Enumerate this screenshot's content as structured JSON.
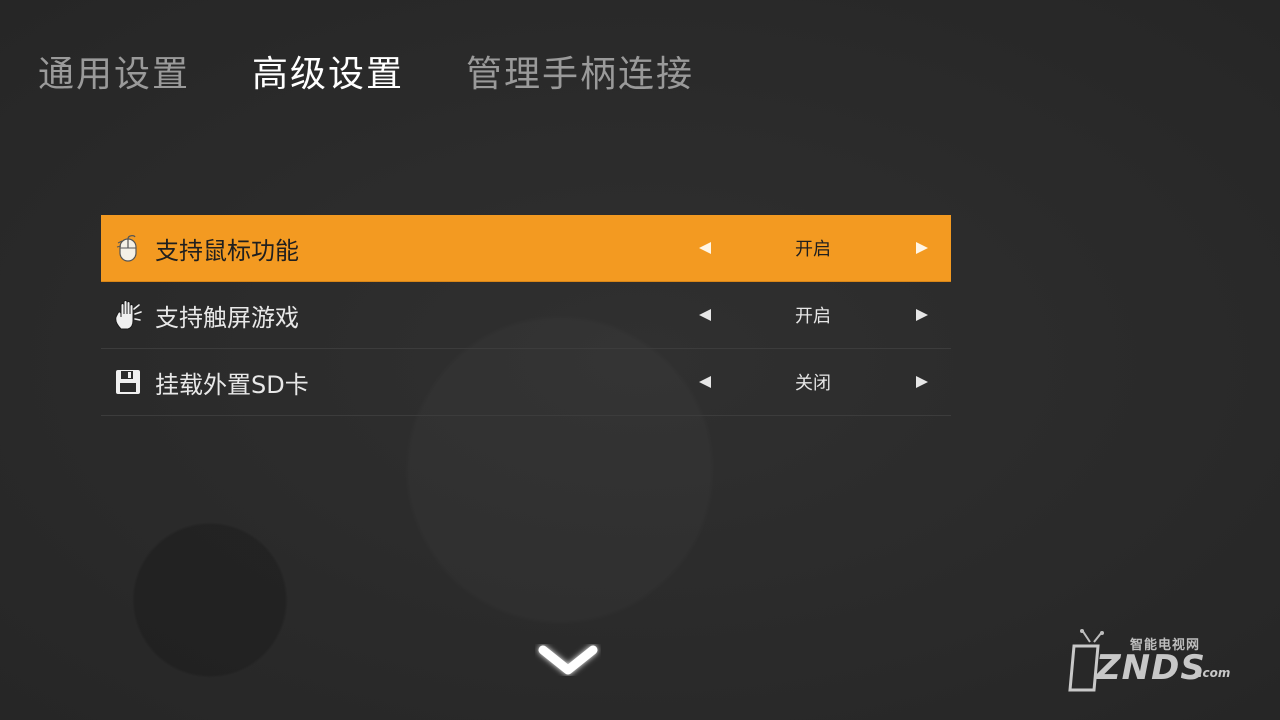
{
  "tabs": [
    {
      "label": "通用设置",
      "active": false
    },
    {
      "label": "高级设置",
      "active": true
    },
    {
      "label": "管理手柄连接",
      "active": false
    }
  ],
  "settings": [
    {
      "icon": "mouse-icon",
      "label": "支持鼠标功能",
      "value": "开启",
      "selected": true
    },
    {
      "icon": "hand-icon",
      "label": "支持触屏游戏",
      "value": "开启",
      "selected": false
    },
    {
      "icon": "floppy-disk-icon",
      "label": "挂载外置SD卡",
      "value": "关闭",
      "selected": false
    }
  ],
  "scroll_indicator": "chevron-down-icon",
  "logo": {
    "chinese": "智能电视网",
    "brand": "ZNDS",
    "suffix": ".com"
  },
  "colors": {
    "accent": "#f39a21",
    "background": "#2b2b2b",
    "inactive_tab": "#9a9a9a"
  }
}
